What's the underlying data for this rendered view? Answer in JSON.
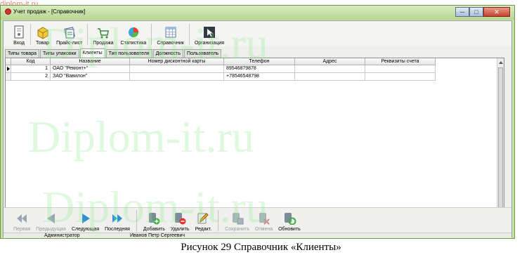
{
  "watermark": {
    "corner": "diplom-it.ru",
    "big": "Diplom-it.ru"
  },
  "window": {
    "title": "Учет продаж - [Справочник]"
  },
  "toolbar": [
    {
      "label": "Вход",
      "icon": "login-icon"
    },
    {
      "label": "Товар",
      "icon": "box-icon"
    },
    {
      "label": "Прайс-лист",
      "icon": "price-list-icon"
    },
    {
      "label": "Продажа",
      "icon": "cart-icon"
    },
    {
      "label": "Статистика",
      "icon": "pie-chart-icon"
    },
    {
      "label": "Справочник",
      "icon": "table-icon"
    },
    {
      "label": "Организация",
      "icon": "cursor-icon"
    }
  ],
  "tabs": [
    {
      "label": "Типы товара"
    },
    {
      "label": "Типы упаковки"
    },
    {
      "label": "Клиенты",
      "active": true
    },
    {
      "label": "Тип пользователя"
    },
    {
      "label": "Должность"
    },
    {
      "label": "Пользователь"
    }
  ],
  "grid": {
    "columns": [
      "Код",
      "Название",
      "Номер дисконтной карты",
      "Телефон",
      "Адрес",
      "Реквизиты счета"
    ],
    "rows": [
      {
        "code": "1",
        "name": "ОАО \"Ремонт+\"",
        "card": "",
        "phone": "89546879878",
        "address": "",
        "account": ""
      },
      {
        "code": "2",
        "name": "ЗАО \"Вавилон\"",
        "card": "",
        "phone": "+78546548798",
        "address": "",
        "account": ""
      }
    ]
  },
  "navigator": {
    "buttons": [
      {
        "label": "Первая",
        "icon": "first-record-icon",
        "enabled": false
      },
      {
        "label": "Предыдущая",
        "icon": "prev-record-icon",
        "enabled": false
      },
      {
        "label": "Следующая",
        "icon": "next-record-icon",
        "enabled": true
      },
      {
        "label": "Последняя",
        "icon": "last-record-icon",
        "enabled": true
      },
      {
        "label": "Добавить",
        "icon": "add-record-icon",
        "enabled": true
      },
      {
        "label": "Удалить",
        "icon": "delete-record-icon",
        "enabled": true
      },
      {
        "label": "Редакт.",
        "icon": "edit-record-icon",
        "enabled": true
      },
      {
        "label": "Сохранить",
        "icon": "save-record-icon",
        "enabled": false
      },
      {
        "label": "Отмена",
        "icon": "cancel-record-icon",
        "enabled": false
      },
      {
        "label": "Обновить",
        "icon": "refresh-icon",
        "enabled": true
      }
    ]
  },
  "status": {
    "role": "Администратор",
    "user": "Иванов Петр Сергеевич"
  },
  "caption": "Рисунок 29 Справочник «Клиенты»"
}
